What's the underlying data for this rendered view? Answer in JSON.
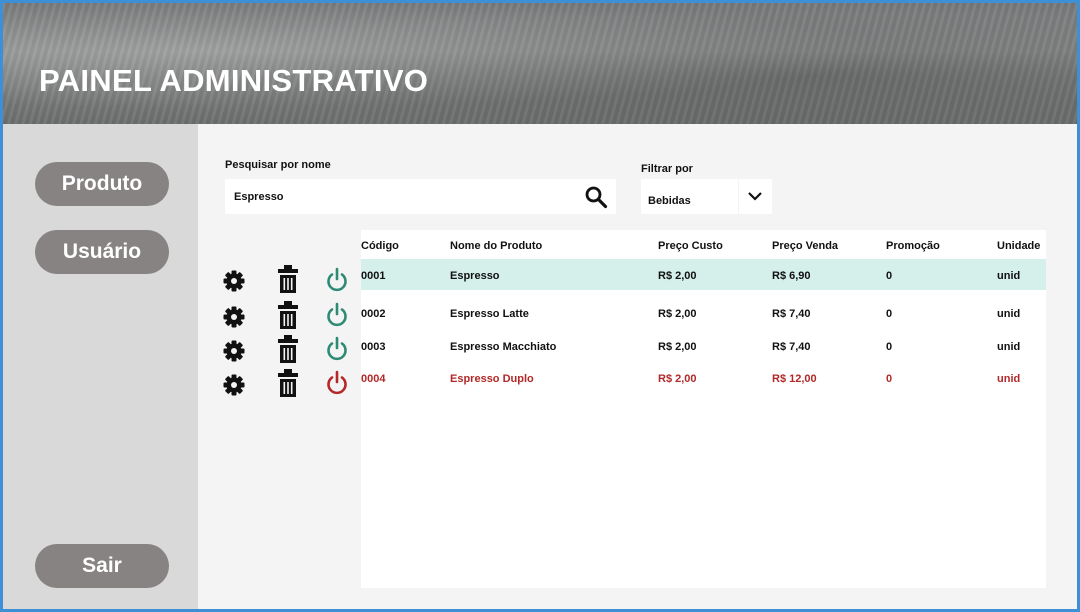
{
  "header": {
    "title": "PAINEL ADMINISTRATIVO"
  },
  "sidebar": {
    "items": [
      {
        "label": "Produto"
      },
      {
        "label": "Usuário"
      }
    ],
    "logout_label": "Sair"
  },
  "search": {
    "label": "Pesquisar por nome",
    "value": "Espresso",
    "icon": "search-icon"
  },
  "filter": {
    "label": "Filtrar por",
    "value": "Bebidas",
    "icon": "chevron-down-icon"
  },
  "table": {
    "columns": [
      "Código",
      "Nome do Produto",
      "Preço Custo",
      "Preço Venda",
      "Promoção",
      "Unidade"
    ],
    "row_actions": [
      "gear-icon",
      "trash-icon",
      "power-icon"
    ],
    "rows": [
      {
        "code": "0001",
        "name": "Espresso",
        "cost": "R$ 2,00",
        "price": "R$ 6,90",
        "promo": "0",
        "unit": "unid",
        "active": true,
        "selected": true
      },
      {
        "code": "0002",
        "name": "Espresso Latte",
        "cost": "R$ 2,00",
        "price": "R$ 7,40",
        "promo": "0",
        "unit": "unid",
        "active": true,
        "selected": false
      },
      {
        "code": "0003",
        "name": "Espresso Macchiato",
        "cost": "R$ 2,00",
        "price": "R$ 7,40",
        "promo": "0",
        "unit": "unid",
        "active": true,
        "selected": false
      },
      {
        "code": "0004",
        "name": "Espresso Duplo",
        "cost": "R$ 2,00",
        "price": "R$ 12,00",
        "promo": "0",
        "unit": "unid",
        "active": false,
        "selected": false
      }
    ]
  },
  "colors": {
    "frame_border": "#3d8fd6",
    "sidebar_button": "#888383",
    "selected_row": "#d5efea",
    "active_power": "#2e8a73",
    "inactive": "#b32828"
  }
}
